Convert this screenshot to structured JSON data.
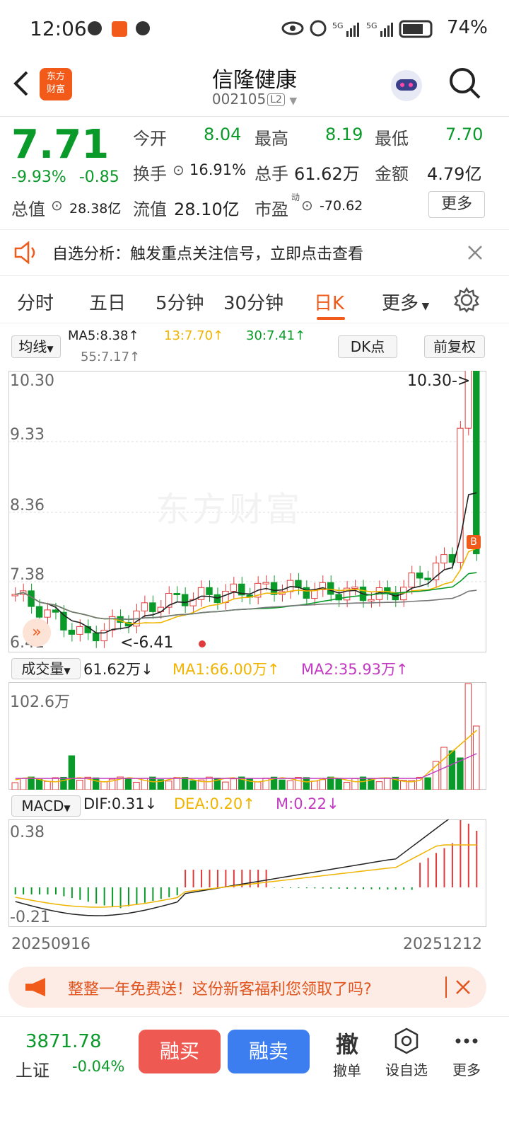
{
  "status_bar": {
    "time": "12:06",
    "battery": "74%"
  },
  "header": {
    "title": "信隆健康",
    "code": "002105",
    "level": "L2",
    "logo_text_1": "东方",
    "logo_text_2": "财富"
  },
  "quote": {
    "price": "7.71",
    "change_pct": "-9.93%",
    "change_abs": "-0.85",
    "open_label": "今开",
    "open": "8.04",
    "high_label": "最高",
    "high": "8.19",
    "low_label": "最低",
    "low": "7.70",
    "turnover_label": "换手",
    "turnover": "16.91%",
    "volume_label": "总手",
    "volume": "61.62万",
    "amount_label": "金额",
    "amount": "4.79亿",
    "total_value_label": "总值",
    "total_value": "28.38亿",
    "float_value_label": "流值",
    "float_value": "28.10亿",
    "pe_label": "市盈",
    "pe_sup": "动",
    "pe": "-70.62",
    "more": "更多"
  },
  "notice": {
    "text": "自选分析：触发重点关注信号，立即点击查看"
  },
  "tabs": [
    {
      "label": "分时"
    },
    {
      "label": "五日"
    },
    {
      "label": "5分钟"
    },
    {
      "label": "30分钟"
    },
    {
      "label": "日K"
    },
    {
      "label": "更多"
    }
  ],
  "ma_legend": {
    "selector": "均线",
    "ma5": "MA5:8.38↑",
    "ma13": "13:7.70↑",
    "ma30": "30:7.41↑",
    "ma55": "55:7.17↑",
    "dk": "DK点",
    "adjust": "前复权"
  },
  "kline": {
    "y_top": "10.30",
    "y_2": "9.33",
    "y_3": "8.36",
    "y_4": "7.38",
    "y_bottom": "6.41",
    "max_note": "10.30->",
    "min_note": "<-6.41",
    "watermark": "东方财富",
    "b_marker": "B"
  },
  "volume_legend": {
    "selector": "成交量",
    "value": "61.62万↓",
    "ma1": "MA1:66.00万↑",
    "ma2": "MA2:35.93万↑",
    "max": "102.6万"
  },
  "macd_legend": {
    "selector": "MACD",
    "dif": "DIF:0.31↓",
    "dea": "DEA:0.20↑",
    "m": "M:0.22↓",
    "y_top": "0.38",
    "y_bottom": "-0.21"
  },
  "dates": {
    "start": "20250916",
    "end": "20251212"
  },
  "banner": {
    "text": "整整一年免费送！这份新客福利您领取了吗?"
  },
  "footer": {
    "index_value": "3871.78",
    "index_name": "上证",
    "index_change": "-0.04%",
    "buy": "融买",
    "sell": "融卖",
    "cancel_icon": "撤",
    "cancel": "撤单",
    "watch": "设自选",
    "more": "更多"
  },
  "colors": {
    "up": "#e23a3a",
    "down": "#0a9a2a",
    "accent": "#f05a1a",
    "ma5": "#222222",
    "ma13": "#f0b400",
    "ma30": "#0a9a2a",
    "ma55": "#777777",
    "ma2": "#c23ac2"
  }
}
